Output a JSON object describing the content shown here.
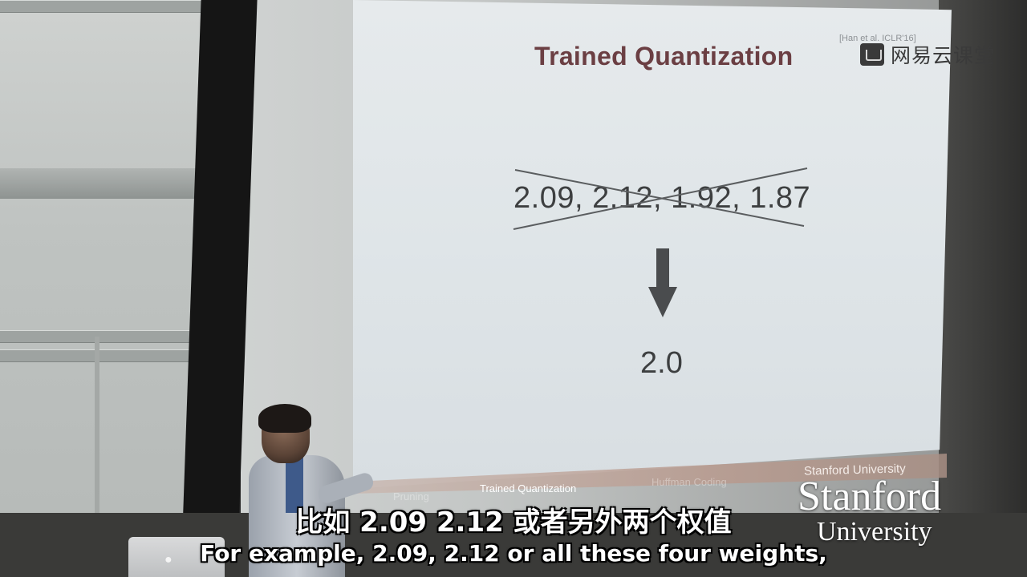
{
  "slide": {
    "title": "Trained Quantization",
    "citation": "[Han et al. ICLR'16]",
    "weights": "2.09,  2.12,  1.92,  1.87",
    "result": "2.0",
    "footer_tabs": [
      "Pruning",
      "Trained Quantization",
      "Huffman Coding"
    ],
    "footer_org": "Stanford University"
  },
  "watermark": {
    "text": "网易云课堂",
    "icon": "video-course-icon"
  },
  "logo": {
    "line1": "Stanford",
    "line2": "University"
  },
  "subtitles": {
    "zh": "比如 2.09 2.12 或者另外两个权值",
    "en": "For example, 2.09, 2.12 or all these four weights,"
  },
  "colors": {
    "title": "#6b3f43",
    "slide_bg": "#e3e8eb",
    "subtitle": "#ffffff"
  }
}
